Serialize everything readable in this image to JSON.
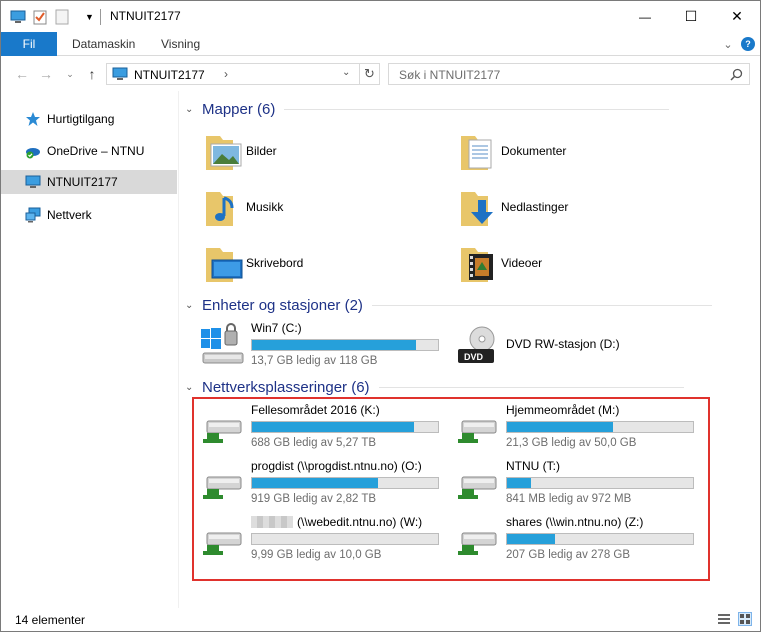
{
  "window": {
    "title": "NTNUIT2177",
    "controls": {
      "minimize": "—",
      "maximize": "☐",
      "close": "✕"
    }
  },
  "ribbon": {
    "tabs": [
      "Fil",
      "Datamaskin",
      "Visning"
    ]
  },
  "address": {
    "path": "NTNUIT2177",
    "search_placeholder": "Søk i NTNUIT2177"
  },
  "sidebar": {
    "items": [
      {
        "label": "Hurtigtilgang",
        "icon": "star-icon"
      },
      {
        "label": "OneDrive – NTNU",
        "icon": "onedrive-icon"
      },
      {
        "label": "NTNUIT2177",
        "icon": "computer-icon",
        "selected": true
      },
      {
        "label": "Nettverk",
        "icon": "network-icon"
      }
    ]
  },
  "groups": {
    "folders": {
      "title": "Mapper (6)"
    },
    "devices": {
      "title": "Enheter og stasjoner (2)"
    },
    "network": {
      "title": "Nettverksplasseringer (6)"
    }
  },
  "folders": [
    {
      "label": "Bilder",
      "icon": "pictures-folder-icon"
    },
    {
      "label": "Dokumenter",
      "icon": "documents-folder-icon"
    },
    {
      "label": "Musikk",
      "icon": "music-folder-icon"
    },
    {
      "label": "Nedlastinger",
      "icon": "downloads-folder-icon"
    },
    {
      "label": "Skrivebord",
      "icon": "desktop-folder-icon"
    },
    {
      "label": "Videoer",
      "icon": "videos-folder-icon"
    }
  ],
  "devices": [
    {
      "name": "Win7 (C:)",
      "free": "13,7 GB ledig av 118 GB",
      "used_fraction": 0.88
    },
    {
      "name": "DVD RW-stasjon (D:)"
    }
  ],
  "network_locations": [
    {
      "name": "Fellesområdet 2016 (K:)",
      "free": "688 GB ledig av 5,27 TB",
      "used_fraction": 0.87
    },
    {
      "name": "Hjemmeområdet (M:)",
      "free": "21,3 GB ledig av 50,0 GB",
      "used_fraction": 0.57
    },
    {
      "name": "progdist (\\\\progdist.ntnu.no) (O:)",
      "free": "919 GB ledig av 2,82 TB",
      "used_fraction": 0.68
    },
    {
      "name": "NTNU (T:)",
      "free": "841 MB ledig av 972 MB",
      "used_fraction": 0.13
    },
    {
      "name": "(\\\\webedit.ntnu.no) (W:)",
      "free": "9,99 GB ledig av 10,0 GB",
      "used_fraction": 0.0
    },
    {
      "name": "shares (\\\\win.ntnu.no) (Z:)",
      "free": "207 GB ledig av 278 GB",
      "used_fraction": 0.26
    }
  ],
  "status": {
    "count": "14 elementer"
  },
  "colors": {
    "accent": "#1979ca",
    "bar_fill": "#26a0da",
    "group_title": "#1e3287",
    "highlight": "#e0322d"
  }
}
